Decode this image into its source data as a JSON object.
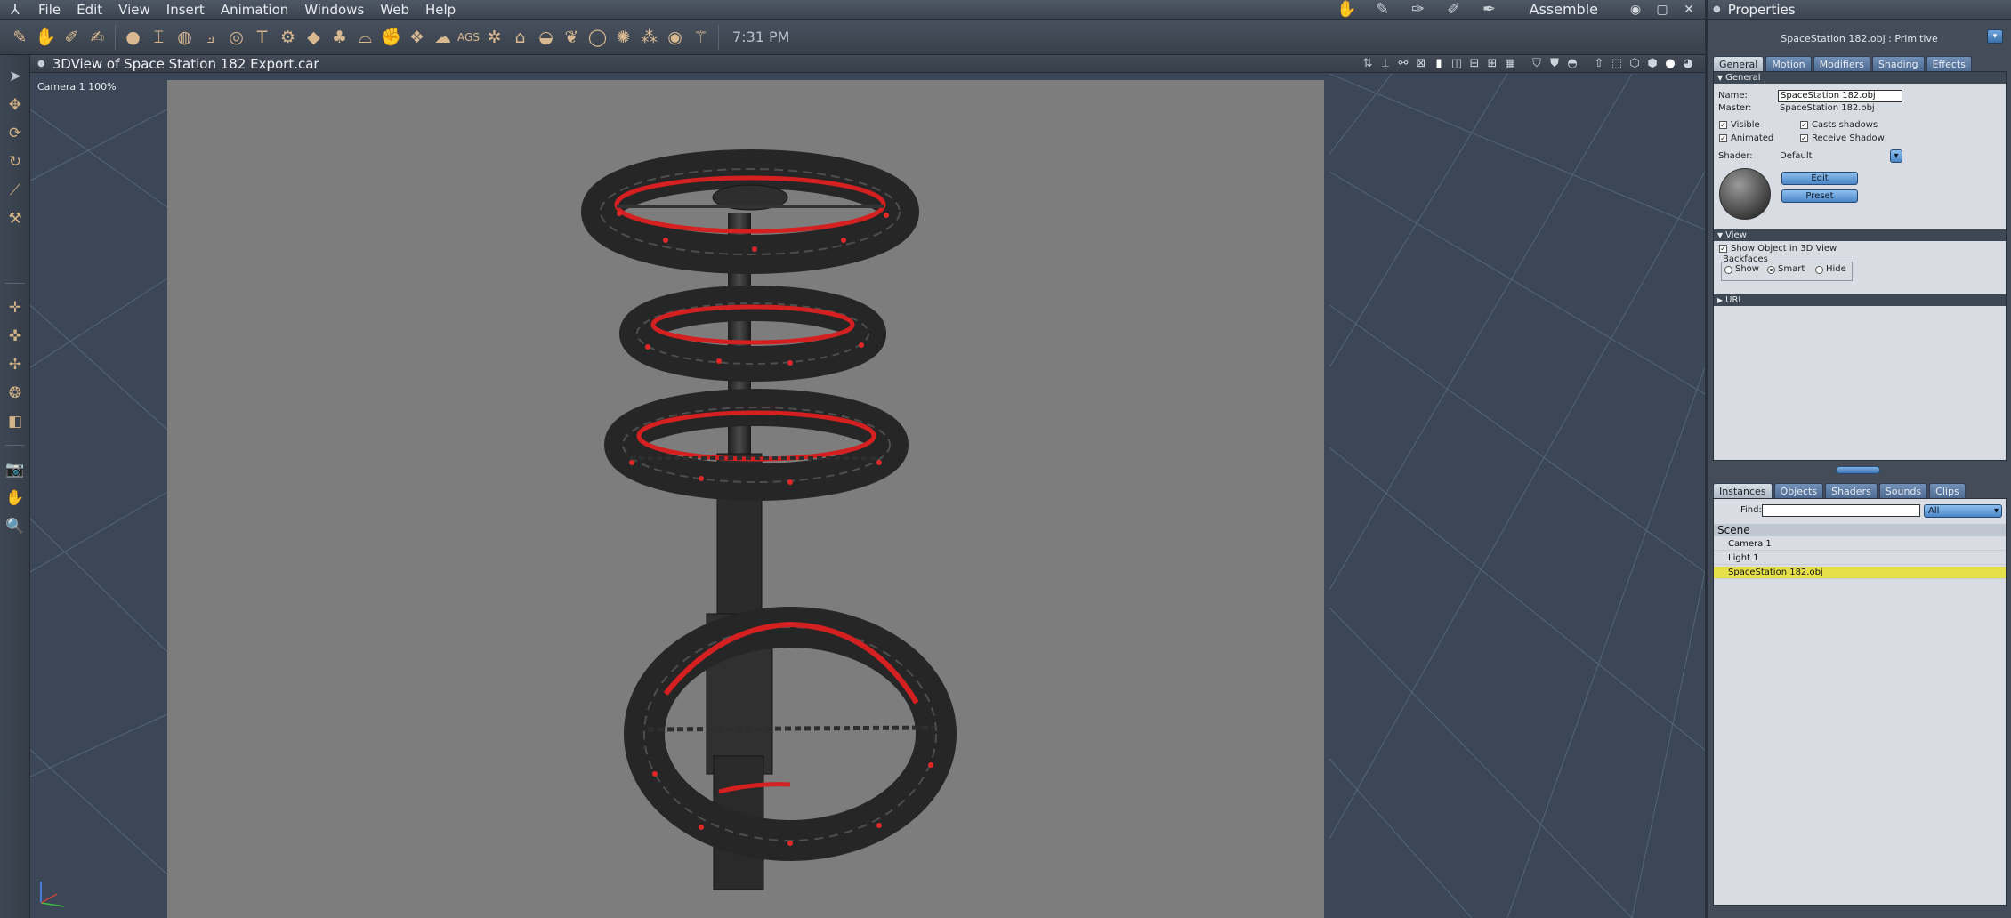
{
  "menubar": {
    "items": [
      "File",
      "Edit",
      "View",
      "Insert",
      "Animation",
      "Windows",
      "Web",
      "Help"
    ],
    "room": "Assemble"
  },
  "toolbar": {
    "time": "7:31 PM"
  },
  "view3d": {
    "title": "3DView of Space Station 182 Export.car",
    "camera_label": "Camera 1 100%"
  },
  "properties": {
    "title": "Properties",
    "subtitle": "SpaceStation 182.obj : Primitive",
    "tabs": [
      "General",
      "Motion",
      "Modifiers",
      "Shading",
      "Effects"
    ],
    "active_tab": "General",
    "general_section": "General",
    "name_label": "Name:",
    "name_value": "SpaceStation 182.obj",
    "master_label": "Master:",
    "master_value": "SpaceStation 182.obj",
    "visible_label": "Visible",
    "visible_checked": true,
    "casts_shadows_label": "Casts shadows",
    "casts_shadows_checked": true,
    "animated_label": "Animated",
    "animated_checked": true,
    "receive_shadow_label": "Receive Shadow",
    "receive_shadow_checked": true,
    "shader_label": "Shader:",
    "shader_value": "Default",
    "edit_button": "Edit",
    "preset_button": "Preset",
    "view_section": "View",
    "show_in_3d_label": "Show Object in 3D View",
    "show_in_3d_checked": true,
    "backfaces_label": "Backfaces",
    "backfaces_options": [
      "Show",
      "Smart",
      "Hide"
    ],
    "backfaces_selected": "Smart",
    "url_section": "URL"
  },
  "browser": {
    "tabs": [
      "Instances",
      "Objects",
      "Shaders",
      "Sounds",
      "Clips"
    ],
    "active_tab": "Instances",
    "find_label": "Find:",
    "find_value": "",
    "filter_value": "All",
    "scene_label": "Scene",
    "items": [
      "Camera 1",
      "Light 1",
      "SpaceStation 182.obj"
    ],
    "selected_item": "SpaceStation 182.obj"
  },
  "colors": {
    "accent_blue": "#4b86c6",
    "selection_yellow": "#e6e04a",
    "render_background": "#7d7d7d",
    "viewport_background": "#3b4657"
  }
}
